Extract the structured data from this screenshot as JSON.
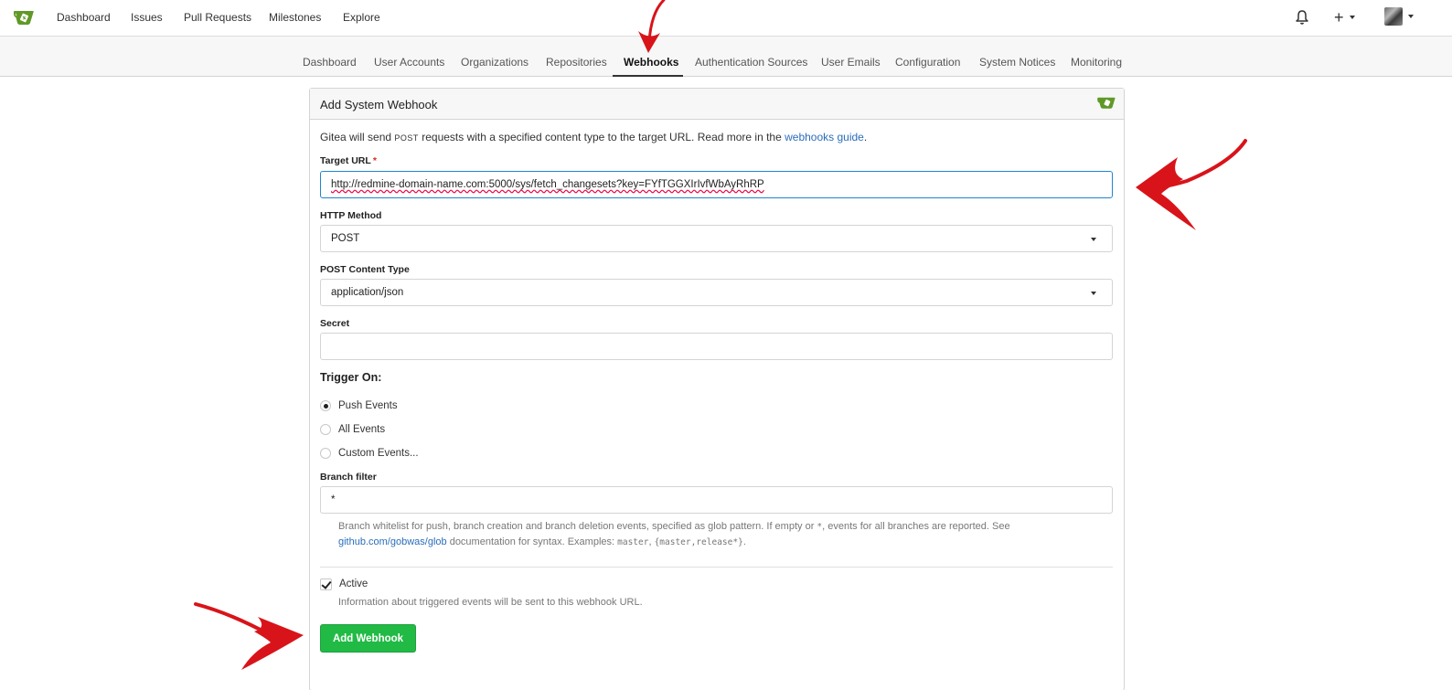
{
  "topnav": {
    "items": [
      "Dashboard",
      "Issues",
      "Pull Requests",
      "Milestones",
      "Explore"
    ],
    "plus_label": "+"
  },
  "admin_tabs": [
    "Dashboard",
    "User Accounts",
    "Organizations",
    "Repositories",
    "Webhooks",
    "Authentication Sources",
    "User Emails",
    "Configuration",
    "System Notices",
    "Monitoring"
  ],
  "active_tab": "Webhooks",
  "form": {
    "title": "Add System Webhook",
    "desc_before": "Gitea will send ",
    "desc_post": "POST",
    "desc_after": " requests with a specified content type to the target URL. Read more in the ",
    "desc_link": "webhooks guide",
    "desc_end": ".",
    "target_url_label": "Target URL",
    "required_mark": "*",
    "target_url_value": "http://redmine-domain-name.com:5000/sys/fetch_changesets?key=FYfTGGXIrIvfWbAyRhRP",
    "http_method_label": "HTTP Method",
    "http_method_value": "POST",
    "content_type_label": "POST Content Type",
    "content_type_value": "application/json",
    "secret_label": "Secret",
    "secret_value": "",
    "trigger_title": "Trigger On:",
    "triggers": [
      {
        "label": "Push Events",
        "checked": true
      },
      {
        "label": "All Events",
        "checked": false
      },
      {
        "label": "Custom Events...",
        "checked": false
      }
    ],
    "branch_filter_label": "Branch filter",
    "branch_filter_value": "*",
    "branch_help_1a": "Branch whitelist for push, branch creation and branch deletion events, specified as glob pattern. If empty or ",
    "branch_help_star": "*",
    "branch_help_1b": ", events for all branches are reported. See",
    "branch_help_link": "github.com/gobwas/glob",
    "branch_help_2a": " documentation for syntax. Examples: ",
    "branch_help_ex1": "master",
    "branch_help_sep": ", ",
    "branch_help_ex2": "{master,release*}",
    "branch_help_end": ".",
    "active_label": "Active",
    "active_checked": true,
    "active_help": "Information about triggered events will be sent to this webhook URL.",
    "submit_label": "Add Webhook"
  },
  "colors": {
    "accent_green": "#21ba45",
    "annotation_red": "#d8141a",
    "link_blue": "#2a6ebb",
    "gitea_green": "#609926"
  },
  "icons": [
    "gitea-logo-icon",
    "bell-icon",
    "plus-icon",
    "avatar",
    "chevron-down-icon"
  ]
}
